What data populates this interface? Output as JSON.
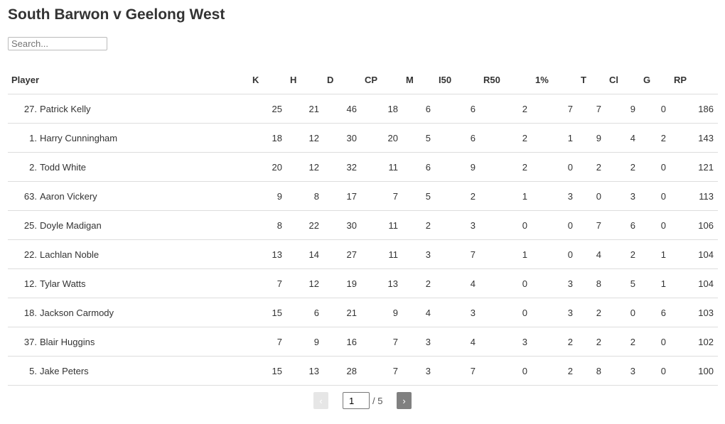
{
  "title": "South Barwon v Geelong West",
  "search": {
    "placeholder": "Search...",
    "value": ""
  },
  "columns": [
    "Player",
    "K",
    "H",
    "D",
    "CP",
    "M",
    "I50",
    "R50",
    "1%",
    "T",
    "Cl",
    "G",
    "RP"
  ],
  "rows": [
    {
      "num": "27.",
      "name": "Patrick Kelly",
      "stats": [
        25,
        21,
        46,
        18,
        6,
        6,
        2,
        7,
        7,
        9,
        0,
        186
      ]
    },
    {
      "num": "1.",
      "name": "Harry Cunningham",
      "stats": [
        18,
        12,
        30,
        20,
        5,
        6,
        2,
        1,
        9,
        4,
        2,
        143
      ]
    },
    {
      "num": "2.",
      "name": "Todd White",
      "stats": [
        20,
        12,
        32,
        11,
        6,
        9,
        2,
        0,
        2,
        2,
        0,
        121
      ]
    },
    {
      "num": "63.",
      "name": "Aaron Vickery",
      "stats": [
        9,
        8,
        17,
        7,
        5,
        2,
        1,
        3,
        0,
        3,
        0,
        113
      ]
    },
    {
      "num": "25.",
      "name": "Doyle Madigan",
      "stats": [
        8,
        22,
        30,
        11,
        2,
        3,
        0,
        0,
        7,
        6,
        0,
        106
      ]
    },
    {
      "num": "22.",
      "name": "Lachlan Noble",
      "stats": [
        13,
        14,
        27,
        11,
        3,
        7,
        1,
        0,
        4,
        2,
        1,
        104
      ]
    },
    {
      "num": "12.",
      "name": "Tylar Watts",
      "stats": [
        7,
        12,
        19,
        13,
        2,
        4,
        0,
        3,
        8,
        5,
        1,
        104
      ]
    },
    {
      "num": "18.",
      "name": "Jackson Carmody",
      "stats": [
        15,
        6,
        21,
        9,
        4,
        3,
        0,
        3,
        2,
        0,
        6,
        103
      ]
    },
    {
      "num": "37.",
      "name": "Blair Huggins",
      "stats": [
        7,
        9,
        16,
        7,
        3,
        4,
        3,
        2,
        2,
        2,
        0,
        102
      ]
    },
    {
      "num": "5.",
      "name": "Jake Peters",
      "stats": [
        15,
        13,
        28,
        7,
        3,
        7,
        0,
        2,
        8,
        3,
        0,
        100
      ]
    }
  ],
  "pagination": {
    "prev": "‹",
    "next": "›",
    "current": "1",
    "total": "/ 5"
  }
}
